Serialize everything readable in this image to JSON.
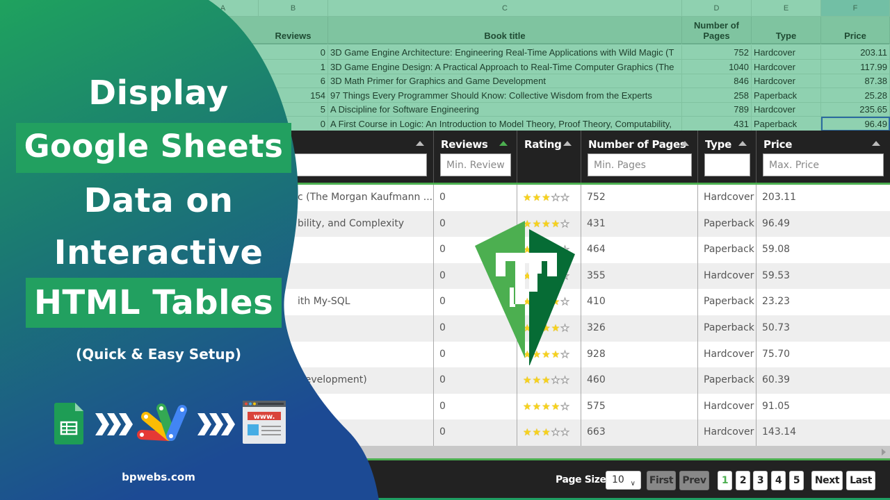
{
  "spreadsheet": {
    "column_letters": [
      "A",
      "B",
      "C",
      "D",
      "E",
      "F"
    ],
    "headers": [
      "",
      "Reviews",
      "Book title",
      "Number of Pages",
      "Type",
      "Price"
    ],
    "rows": [
      {
        "reviews": "0",
        "title": "3D Game Engine Architecture: Engineering Real-Time Applications with Wild Magic (T",
        "pages": "752",
        "type": "Hardcover",
        "price": "203.11"
      },
      {
        "reviews": "1",
        "title": "3D Game Engine Design: A Practical Approach to Real-Time Computer Graphics (The",
        "pages": "1040",
        "type": "Hardcover",
        "price": "117.99"
      },
      {
        "reviews": "6",
        "title": "3D Math Primer for Graphics and Game Development",
        "pages": "846",
        "type": "Hardcover",
        "price": "87.38"
      },
      {
        "reviews": "154",
        "title": "97 Things Every Programmer Should Know: Collective Wisdom from the Experts",
        "pages": "258",
        "type": "Paperback",
        "price": "25.28"
      },
      {
        "reviews": "5",
        "title": "A Discipline for Software Engineering",
        "pages": "789",
        "type": "Hardcover",
        "price": "235.65"
      },
      {
        "reviews": "0",
        "title": "A First Course in Logic: An Introduction to Model Theory, Proof Theory, Computability,",
        "pages": "431",
        "type": "Paperback",
        "price": "96.49"
      }
    ]
  },
  "table": {
    "columns": [
      {
        "label": "",
        "placeholder": "",
        "sort_active": false
      },
      {
        "label": "Reviews",
        "placeholder": "Min. Review",
        "sort_active": true
      },
      {
        "label": "Rating",
        "placeholder": null,
        "sort_active": false
      },
      {
        "label": "Number of Pages",
        "placeholder": "Min. Pages",
        "sort_active": false
      },
      {
        "label": "Type",
        "placeholder": "",
        "sort_active": false
      },
      {
        "label": "Price",
        "placeholder": "Max. Price",
        "sort_active": false
      }
    ],
    "rows": [
      {
        "title": "c (The Morgan Kaufmann ...",
        "reviews": "0",
        "rating": 3,
        "pages": "752",
        "type": "Hardcover",
        "price": "203.11"
      },
      {
        "title": "bility, and Complexity",
        "reviews": "0",
        "rating": 4,
        "pages": "431",
        "type": "Paperback",
        "price": "96.49"
      },
      {
        "title": "",
        "reviews": "0",
        "rating": 3,
        "pages": "464",
        "type": "Paperback",
        "price": "59.08"
      },
      {
        "title": "",
        "reviews": "0",
        "rating": 4,
        "pages": "355",
        "type": "Hardcover",
        "price": "59.53"
      },
      {
        "title": "ith My-SQL",
        "reviews": "0",
        "rating": 4,
        "pages": "410",
        "type": "Paperback",
        "price": "23.23"
      },
      {
        "title": "",
        "reviews": "0",
        "rating": 4,
        "pages": "326",
        "type": "Paperback",
        "price": "50.73"
      },
      {
        "title": "",
        "reviews": "0",
        "rating": 4,
        "pages": "928",
        "type": "Hardcover",
        "price": "75.70"
      },
      {
        "title": " Development)",
        "reviews": "0",
        "rating": 3,
        "pages": "460",
        "type": "Paperback",
        "price": "60.39"
      },
      {
        "title": "",
        "reviews": "0",
        "rating": 4,
        "pages": "575",
        "type": "Hardcover",
        "price": "91.05"
      },
      {
        "title": "",
        "reviews": "0",
        "rating": 3,
        "pages": "663",
        "type": "Hardcover",
        "price": "143.14"
      }
    ],
    "max_rating": 5
  },
  "pagination": {
    "page_size_label": "Page Size",
    "page_size_value": "10",
    "first_label": "First",
    "prev_label": "Prev",
    "pages": [
      "1",
      "2",
      "3",
      "4",
      "5"
    ],
    "current_page": "1",
    "next_label": "Next",
    "last_label": "Last"
  },
  "promo": {
    "line1": "Display",
    "line2": "Google Sheets",
    "line3": "Data on",
    "line4": "Interactive",
    "line5": "HTML Tables",
    "subtitle": "(Quick & Easy Setup)",
    "site": "bpwebs.com",
    "icons": [
      "google-sheets-icon",
      "arrows-icon",
      "apps-script-icon",
      "arrows-icon",
      "webpage-icon"
    ],
    "highlight_color": "#22a060"
  },
  "colors": {
    "accent_green": "#4caf50",
    "header_dark": "#222222",
    "sheet_green": "#8fd1b0"
  }
}
